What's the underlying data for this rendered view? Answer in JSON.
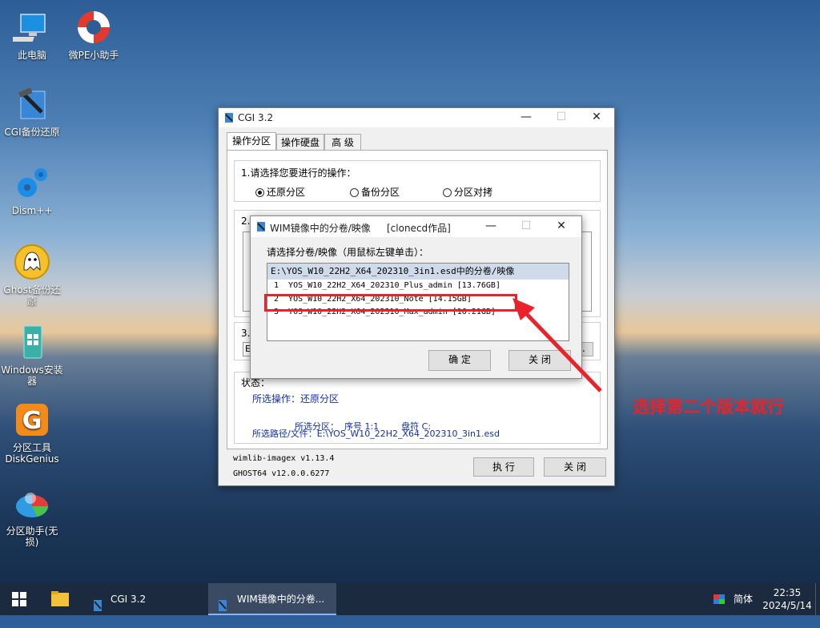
{
  "desktop": {
    "icons": [
      {
        "label": "此电脑",
        "icon": "computer-icon"
      },
      {
        "label": "微PE小助手",
        "icon": "lifebuoy-icon"
      },
      {
        "label": "CGI备份还原",
        "icon": "cgi-hammer-icon"
      },
      {
        "label": "Dism++",
        "icon": "gear-icon"
      },
      {
        "label": "Ghost备份还原",
        "icon": "ghost-icon"
      },
      {
        "label": "Windows安装器",
        "icon": "windows-installer-icon"
      },
      {
        "label": "分区工具DiskGenius",
        "icon": "diskgenius-icon"
      },
      {
        "label": "分区助手(无损)",
        "icon": "partition-assistant-icon"
      }
    ]
  },
  "cgi": {
    "title": "CGI 3.2",
    "tabs": [
      "操作分区",
      "操作硬盘",
      "高 级"
    ],
    "section1_title": "1.请选择您要进行的操作：",
    "radios": [
      {
        "label": "还原分区",
        "checked": true
      },
      {
        "label": "备份分区",
        "checked": false
      },
      {
        "label": "分区对拷",
        "checked": false
      }
    ],
    "section2_prefix": "2.",
    "section3_prefix": "3.",
    "section3_field_prefix": "E",
    "status_title": "状态：",
    "status_op": "所选操作：还原分区",
    "status_part": "所选分区：  序号 1:1        盘符 C:",
    "status_path": "所选路径/文件：E:\\YOS_W10_22H2_X64_202310_3in1.esd",
    "version1": "wimlib-imagex v1.13.4",
    "version2": "GHOST64 v12.0.0.6277",
    "execute_label": "执 行",
    "close_label": "关 闭",
    "browse_label": ".."
  },
  "wim": {
    "title": "WIM镜像中的分卷/映像",
    "title_suffix": "[clonecd作品]",
    "prompt": "请选择分卷/映像（用鼠标左键单击）：",
    "list_header": "E:\\YOS_W10_22H2_X64_202310_3in1.esd中的分卷/映像",
    "items": [
      "1  YOS_W10_22H2_X64_202310_Plus_admin [13.76GB]",
      "2  YOS_W10_22H2_X64_202310_Note [14.15GB]",
      "3  YOS_W10_22H2_X64_202310_Max_admin [16.21GB]"
    ],
    "ok_label": "确 定",
    "close_label": "关 闭"
  },
  "annotation": {
    "text": "选择第二个版本就行",
    "color": "#e8232a"
  },
  "taskbar": {
    "task1": "CGI 3.2",
    "task2": "WIM镜像中的分卷...",
    "ime": "简体",
    "time": "22:35",
    "date": "2024/5/14"
  }
}
